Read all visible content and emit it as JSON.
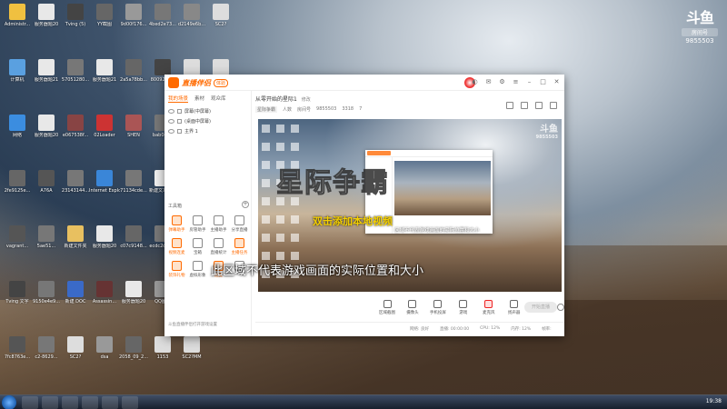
{
  "watermark": {
    "brand": "斗鱼",
    "room_label": "房间号",
    "room_number": "9855503"
  },
  "desktop_icons": [
    {
      "label": "Administr...",
      "color": "#f0c040"
    },
    {
      "label": "服务器题20",
      "color": "#e8e8e8"
    },
    {
      "label": "Tving (5)",
      "color": "#444"
    },
    {
      "label": "YY截图",
      "color": "#666"
    },
    {
      "label": "9d00f176...",
      "color": "#999"
    },
    {
      "label": "4bed2e73...",
      "color": "#777"
    },
    {
      "label": "d2149e6b...",
      "color": "#888"
    },
    {
      "label": "SC2?",
      "color": "#ddd"
    },
    {
      "label": "计算机",
      "color": "#5aa0e0"
    },
    {
      "label": "服务器题21",
      "color": "#e8e8e8"
    },
    {
      "label": "57051280...",
      "color": "#777"
    },
    {
      "label": "服务器题21",
      "color": "#e8e8e8"
    },
    {
      "label": "2a5a78bb...",
      "color": "#666"
    },
    {
      "label": "80092ac...",
      "color": "#444"
    },
    {
      "label": "1153",
      "color": "#ddd"
    },
    {
      "label": "SC2?M2",
      "color": "#ddd"
    },
    {
      "label": "网络",
      "color": "#3b8de0"
    },
    {
      "label": "服务器题20",
      "color": "#e8e8e8"
    },
    {
      "label": "e067538f...",
      "color": "#844"
    },
    {
      "label": "02Loader",
      "color": "#c33"
    },
    {
      "label": "SHEN",
      "color": "#a55"
    },
    {
      "label": "bab0d76",
      "color": "#777"
    },
    {
      "label": "回收站",
      "color": "#ccc"
    },
    {
      "label": "新建文本文档",
      "color": "#eee"
    },
    {
      "label": "2fe9125e...",
      "color": "#666"
    },
    {
      "label": "A76A",
      "color": "#555"
    },
    {
      "label": "23143144...",
      "color": "#777"
    },
    {
      "label": "Internet Explorer",
      "color": "#3a86d8"
    },
    {
      "label": "71134cde...",
      "color": "#777"
    },
    {
      "label": "新建文本文档",
      "color": "#eee"
    },
    {
      "label": "宽带连接",
      "color": "#3a7ac8"
    },
    {
      "label": "1363",
      "color": "#ddd"
    },
    {
      "label": "vagrant...",
      "color": "#555"
    },
    {
      "label": "5ae51...",
      "color": "#777"
    },
    {
      "label": "新建文件夹",
      "color": "#e8c060"
    },
    {
      "label": "服务器题20",
      "color": "#e8e8e8"
    },
    {
      "label": "c07c9148...",
      "color": "#666"
    },
    {
      "label": "ecdc2d96...",
      "color": "#777"
    },
    {
      "label": "bcec1...",
      "color": "#666"
    },
    {
      "label": "新建文件夹",
      "color": "#e8c060"
    },
    {
      "label": "Tving 文字",
      "color": "#444"
    },
    {
      "label": "9150e4e9...",
      "color": "#777"
    },
    {
      "label": "新建 DOC",
      "color": "#3a6ac8"
    },
    {
      "label": "Assassin...",
      "color": "#633"
    },
    {
      "label": "服务器题20",
      "color": "#e8e8e8"
    },
    {
      "label": "QQ图片",
      "color": "#999"
    },
    {
      "label": "服务器题20",
      "color": "#e8e8e8"
    },
    {
      "label": "dedada",
      "color": "#bbb"
    },
    {
      "label": "7fc8763e...",
      "color": "#555"
    },
    {
      "label": "c2-8629...",
      "color": "#777"
    },
    {
      "label": "SC2?",
      "color": "#ddd"
    },
    {
      "label": "dsa",
      "color": "#999"
    },
    {
      "label": "2058_09_2...",
      "color": "#666"
    },
    {
      "label": "1153",
      "color": "#ddd"
    },
    {
      "label": "SC2?MM",
      "color": "#ddd"
    }
  ],
  "app": {
    "name": "直播伴侣",
    "version": "体验",
    "tabs": [
      "我的场景",
      "素材",
      "观众库"
    ],
    "scenes": [
      "屏幕(中屏幕)",
      "(桌面中屏幕)",
      "主界 1"
    ],
    "tools_label": "工具箱",
    "tools": [
      {
        "label": "弹幕助手",
        "hot": true
      },
      {
        "label": "房管助手",
        "hot": false
      },
      {
        "label": "主播助手",
        "hot": false
      },
      {
        "label": "分享直播",
        "hot": false
      },
      {
        "label": "视频连麦",
        "hot": true
      },
      {
        "label": "宝箱",
        "hot": false
      },
      {
        "label": "直播统计",
        "hot": false
      },
      {
        "label": "主播任务",
        "hot": true
      },
      {
        "label": "装饰礼物",
        "hot": true
      },
      {
        "label": "虚拟形象",
        "hot": false
      },
      {
        "label": "连麦",
        "hot": true
      },
      {
        "label": "",
        "hot": false
      }
    ],
    "left_footer": "斗鱼直播伴侣打开游戏设置",
    "room_title": "从零开始的星际1",
    "room_edit": "修改",
    "room_meta": [
      "星际争霸",
      "人数",
      "房间号",
      "9855503",
      "3318",
      "7"
    ],
    "preview": {
      "big_text": "星际争霸",
      "yellow_text": "双击添加本地视频",
      "small_text": "区域不代表游戏画面的实际位置和大小",
      "corner_brand": "斗鱼",
      "corner_num": "9855503"
    },
    "controls": [
      {
        "label": "区域截图",
        "hot": false
      },
      {
        "label": "摄像头",
        "hot": false
      },
      {
        "label": "手机投屏",
        "hot": false
      },
      {
        "label": "游戏",
        "hot": false
      },
      {
        "label": "麦克风",
        "hot": true
      },
      {
        "label": "扬声器",
        "hot": false
      }
    ],
    "live_button": "开始直播",
    "status": [
      "网络: 良好",
      "直播: 00:00:00",
      "CPU: 12%",
      "内存: 12%",
      "帧率:"
    ]
  },
  "subtitle": "此区域不代表游戏画面的实际位置和大小",
  "tray_time": "19:38"
}
